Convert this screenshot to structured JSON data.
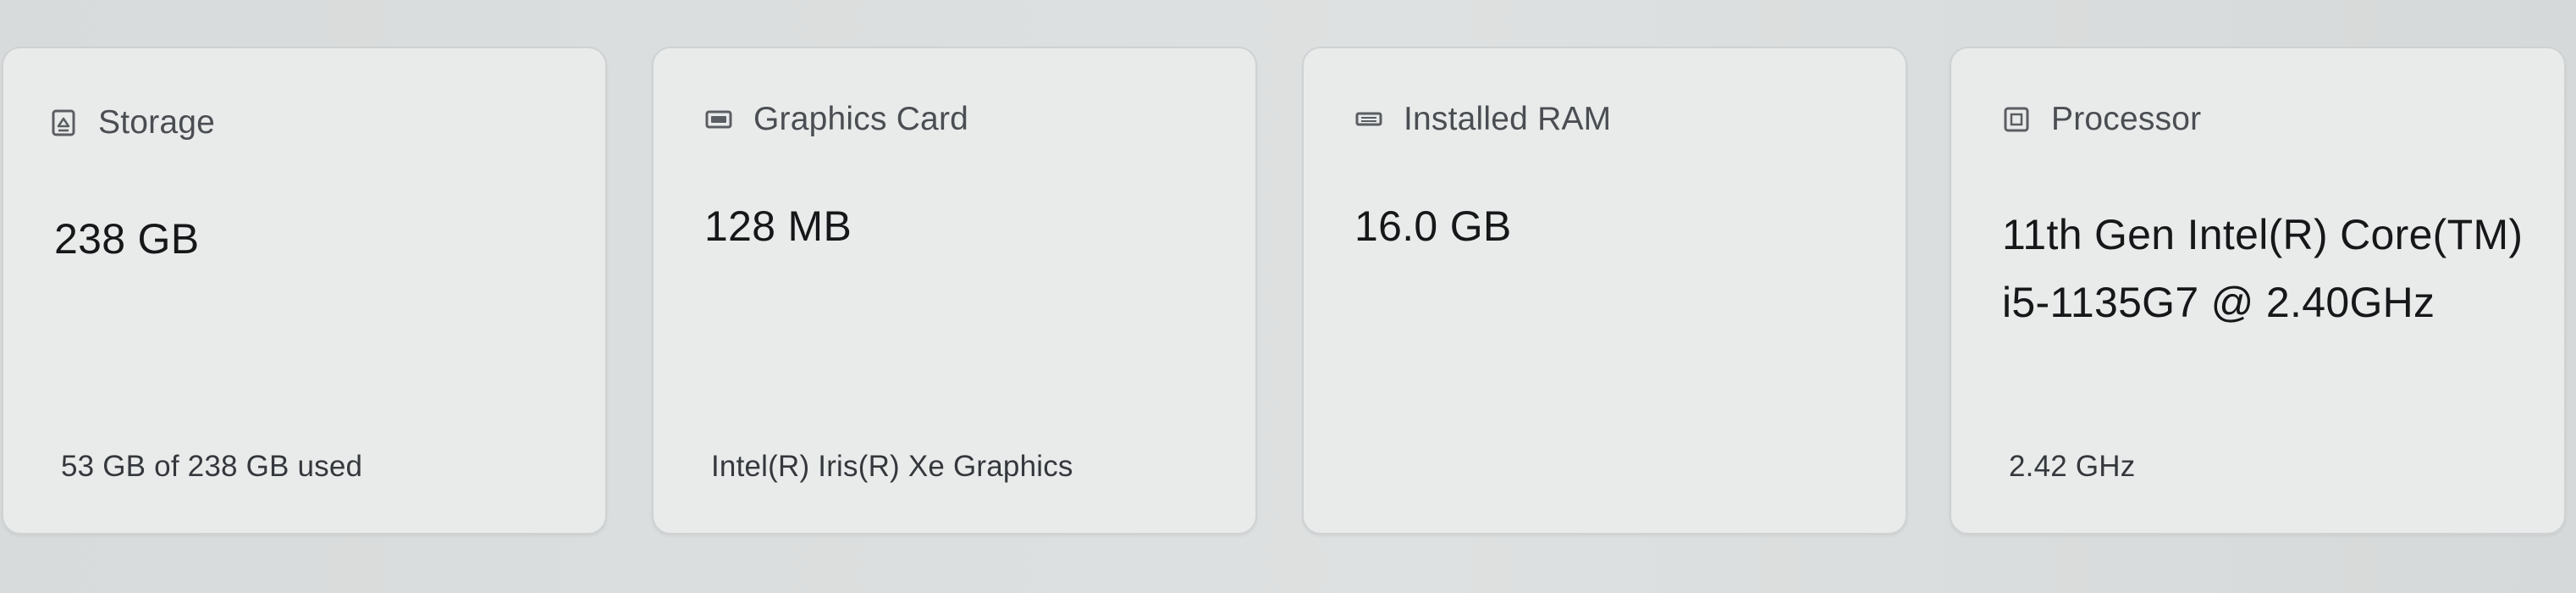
{
  "cards": [
    {
      "icon": "storage-icon",
      "title": "Storage",
      "value": "238 GB",
      "footer": "53 GB of 238 GB used"
    },
    {
      "icon": "graphics-card-icon",
      "title": "Graphics Card",
      "value": "128 MB",
      "footer": "Intel(R) Iris(R) Xe Graphics"
    },
    {
      "icon": "ram-icon",
      "title": "Installed RAM",
      "value": "16.0 GB",
      "footer": ""
    },
    {
      "icon": "processor-icon",
      "title": "Processor",
      "value": "11th Gen Intel(R) Core(TM) i5-1135G7 @ 2.40GHz",
      "footer": "2.42 GHz"
    }
  ],
  "colors": {
    "background": "#d9dcdc",
    "card": "#e9ebeb",
    "border": "#cfd2d3",
    "title_text": "#4a4e52",
    "value_text": "#151719"
  }
}
